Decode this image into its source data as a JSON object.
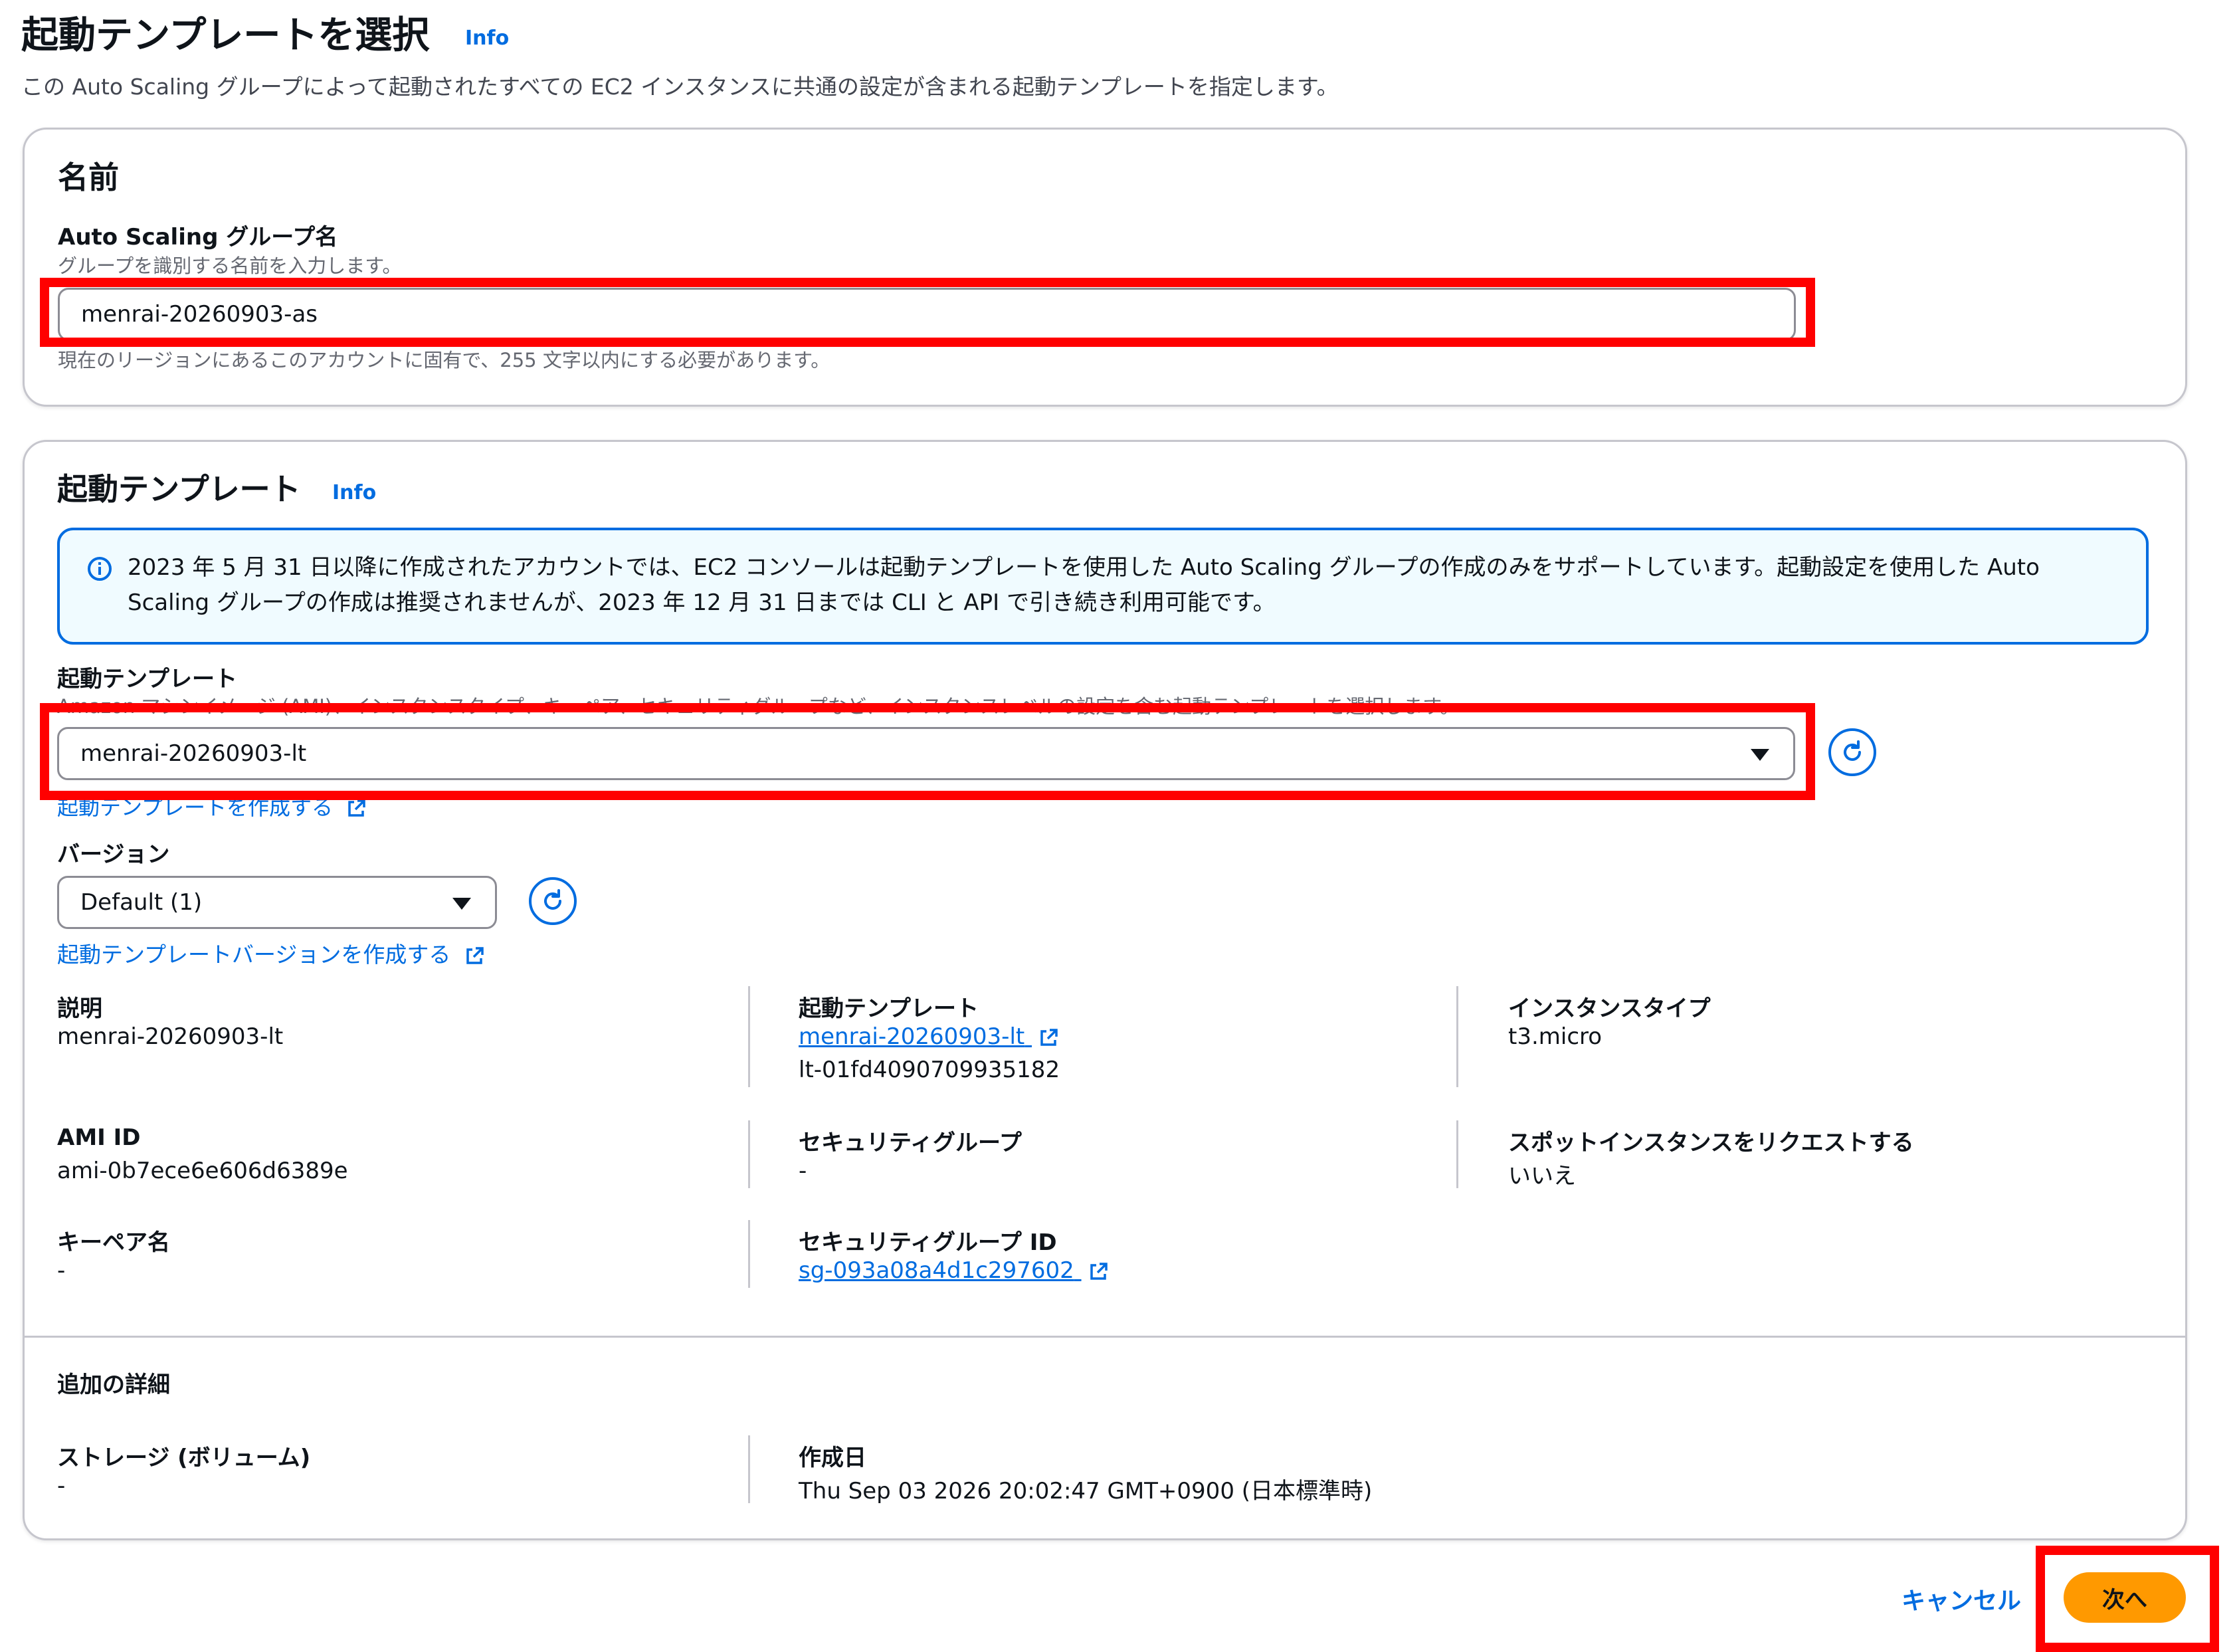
{
  "page": {
    "title": "起動テンプレートを選択",
    "info_link": "Info",
    "description": "この Auto Scaling グループによって起動されたすべての EC2 インスタンスに共通の設定が含まれる起動テンプレートを指定します。"
  },
  "name_panel": {
    "heading": "名前",
    "field_label": "Auto Scaling グループ名",
    "field_hint": "グループを識別する名前を入力します。",
    "field_value": "menrai-20260903-as",
    "field_constraint": "現在のリージョンにあるこのアカウントに固有で、255 文字以内にする必要があります。"
  },
  "template_panel": {
    "heading": "起動テンプレート",
    "info_link": "Info",
    "alert_text": "2023 年 5 月 31 日以降に作成されたアカウントでは、EC2 コンソールは起動テンプレートを使用した Auto Scaling グループの作成のみをサポートしています。起動設定を使用した Auto Scaling グループの作成は推奨されませんが、2023 年 12 月 31 日までは CLI と API で引き続き利用可能です。",
    "template_label": "起動テンプレート",
    "template_hint": "Amazon マシンイメージ (AMI)、インスタンスタイプ、キーペア、セキュリティグループなど、インスタンスレベルの設定を含む起動テンプレートを選択します。",
    "template_value": "menrai-20260903-lt",
    "create_template_link": "起動テンプレートを作成する",
    "version_label": "バージョン",
    "version_value": "Default (1)",
    "create_version_link": "起動テンプレートバージョンを作成する",
    "details": {
      "description_label": "説明",
      "description_value": "menrai-20260903-lt",
      "template_label": "起動テンプレート",
      "template_link": "menrai-20260903-lt",
      "template_id": "lt-01fd4090709935182",
      "instance_type_label": "インスタンスタイプ",
      "instance_type_value": "t3.micro",
      "ami_label": "AMI ID",
      "ami_value": "ami-0b7ece6e606d6389e",
      "sg_label": "セキュリティグループ",
      "sg_value": "-",
      "spot_label": "スポットインスタンスをリクエストする",
      "spot_value": "いいえ",
      "keypair_label": "キーペア名",
      "keypair_value": "-",
      "sg_id_label": "セキュリティグループ ID",
      "sg_id_link": "sg-093a08a4d1c297602"
    },
    "additional": {
      "heading": "追加の詳細",
      "storage_label": "ストレージ (ボリューム)",
      "storage_value": "-",
      "created_label": "作成日",
      "created_value": "Thu Sep 03 2026 20:02:47 GMT+0900 (日本標準時)"
    }
  },
  "footer": {
    "cancel_label": "キャンセル",
    "next_label": "次へ"
  },
  "colors": {
    "accent": "#006ce0",
    "primary_button": "#ff9900",
    "highlight": "#ff0000",
    "page_bg": "#ffffff"
  }
}
